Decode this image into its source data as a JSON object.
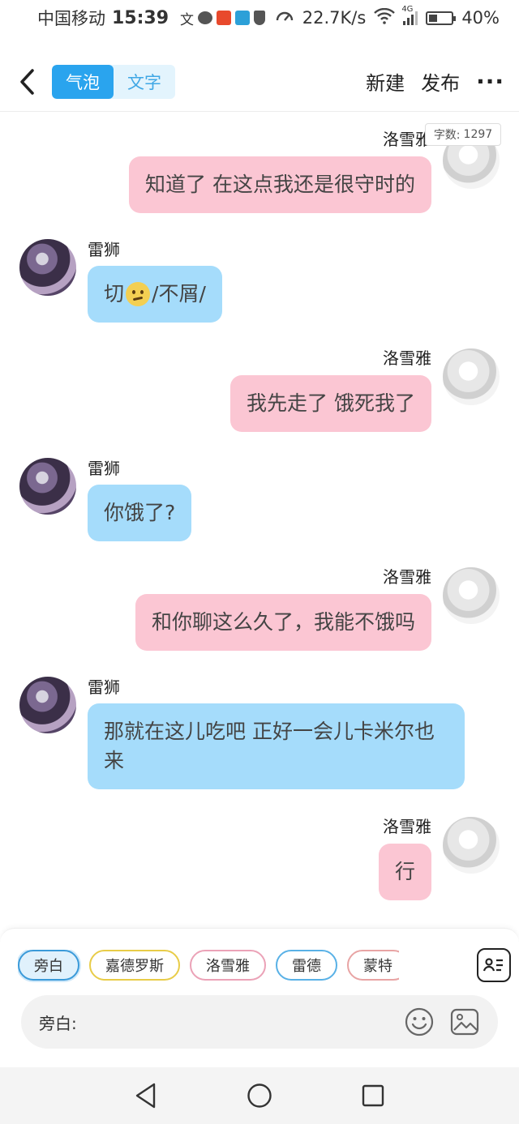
{
  "status_bar": {
    "carrier": "中国移动",
    "time": "15:39",
    "network_speed": "22.7K/s",
    "signal": "4G",
    "battery": "40%",
    "battery_level": 0.4
  },
  "header": {
    "tab_bubble": "气泡",
    "tab_text": "文字",
    "new_label": "新建",
    "publish_label": "发布",
    "more_label": "···"
  },
  "word_count": {
    "label": "字数:",
    "value": "1297"
  },
  "messages": [
    {
      "side": "right",
      "name": "洛雪雅",
      "text": "知道了 在这点我还是很守时的"
    },
    {
      "side": "left",
      "name": "雷狮",
      "text": "切",
      "emoji": "confused-face-emoji",
      "suffix": "/不屑/"
    },
    {
      "side": "right",
      "name": "洛雪雅",
      "text": "我先走了 饿死我了"
    },
    {
      "side": "left",
      "name": "雷狮",
      "text": "你饿了?"
    },
    {
      "side": "right",
      "name": "洛雪雅",
      "text": "和你聊这么久了，我能不饿吗"
    },
    {
      "side": "left",
      "name": "雷狮",
      "text": "那就在这儿吃吧 正好一会儿卡米尔也来"
    },
    {
      "side": "right",
      "name": "洛雪雅",
      "text": "行"
    }
  ],
  "composer": {
    "chips": [
      "旁白",
      "嘉德罗斯",
      "洛雪雅",
      "雷德",
      "蒙特"
    ],
    "input_label": "旁白:",
    "input_value": ""
  },
  "colors": {
    "pink_bubble": "#fbc6d3",
    "blue_bubble": "#a5dcfb",
    "accent": "#2aa4ee"
  }
}
